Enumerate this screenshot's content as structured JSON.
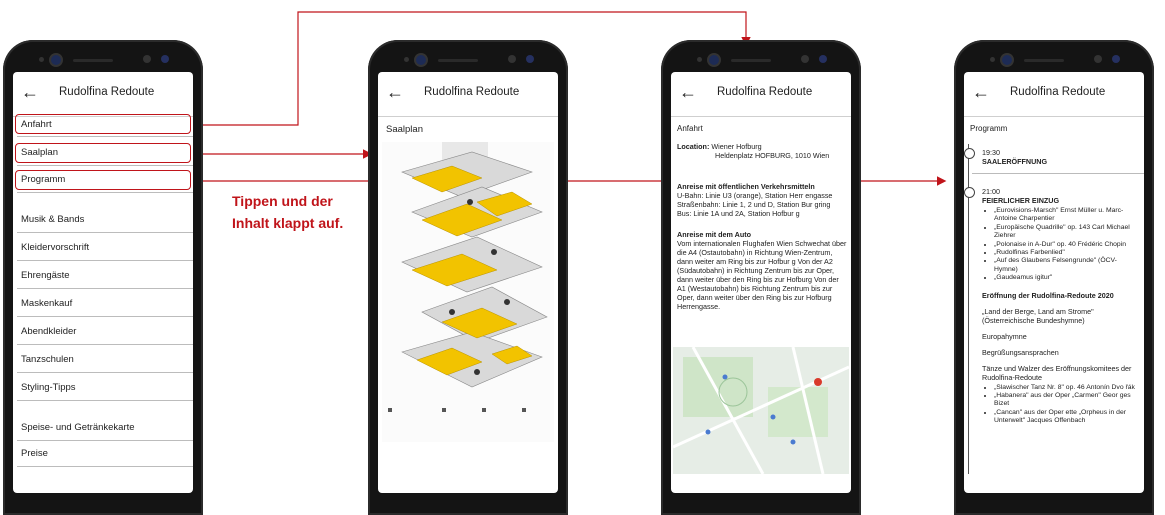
{
  "phone1": {
    "title": "Rudolfina Redoute",
    "menu": [
      "Anfahrt",
      "Saalplan",
      "Programm",
      "Musik & Bands",
      "Kleidervorschrift",
      "Ehrengäste",
      "Maskenkauf",
      "Abendkleider",
      "Tanzschulen",
      "Styling-Tipps",
      "Speise- und Getränkekarte",
      "Preise"
    ]
  },
  "annotation": {
    "line1": "Tippen und der",
    "line2": "Inhalt klappt auf."
  },
  "phone2": {
    "title": "Rudolfina Redoute",
    "section": "Saalplan"
  },
  "phone3": {
    "title": "Rudolfina Redoute",
    "section": "Anfahrt",
    "location_label": "Location:",
    "location_line1": "Wiener Hofburg",
    "location_line2": "Heldenplatz HOFBURG, 1010 Wien",
    "oeffi_heading": "Anreise mit öffentlichen Verkehrsmitteln",
    "oeffi_lines": [
      "U-Bahn: Linie U3 (orange), Station Herr engasse",
      "Straßenbahn: Linie 1, 2 und D, Station Bur gring",
      "Bus: Linie 1A und 2A, Station Hofbur g"
    ],
    "auto_heading": "Anreise mit dem Auto",
    "auto_text": "Vom internationalen Flughafen Wien Schwechat über die A4 (Ostautobahn) in Richtung Wien-Zentrum, dann weiter am Ring bis zur Hofbur g Von der A2 (Südautobahn) in Richtung Zentrum bis zur Oper, dann weiter über den Ring bis zur Hofburg Von der A1 (Westautobahn) bis Richtung Zentrum bis zur Oper, dann weiter über den Ring bis zur Hofburg Herrengasse."
  },
  "phone4": {
    "title": "Rudolfina Redoute",
    "section": "Programm",
    "time1": "19:30",
    "event1": "SAALERÖFFNUNG",
    "time2": "21:00",
    "event2": "FEIERLICHER EINZUG",
    "list1": [
      "„Eurovisions-Marsch\" Ernst Müller u. Marc-Antoine Charpentier",
      "„Europäische Quadrille\" op. 143 Carl Michael Ziehrer",
      "„Polonaise in A-Dur\" op. 40 Frédéric Chopin",
      "„Rudolfinas Farbenlied\"",
      "„Auf des Glaubens Felsengrunde\" (ÖCV-Hymne)",
      "„Gaudeamus igitur\""
    ],
    "opening_heading": "Eröffnung der Rudolfina-Redoute 2020",
    "opening_anthem": "„Land der Berge, Land am Strome\" (Österreichische Bundeshymne)",
    "europe_anthem": "Europahymne",
    "welcome": "Begrüßungsansprachen",
    "dances": "Tänze und Walzer des Eröffnungskomitees der Rudolfina-Redoute",
    "list2": [
      "„Slawischer Tanz Nr. 8\" op. 46 Antonín Dvo řák",
      "„Habanera\" aus der Oper „Carmen\" Geor ges Bizet",
      "„Cancan\" aus der Oper ette „Orpheus in der Unterwelt\" Jacques Offenbach"
    ]
  },
  "colors": {
    "accent": "#c0141a",
    "phone": "#141414",
    "plan_yellow": "#f2c300"
  }
}
